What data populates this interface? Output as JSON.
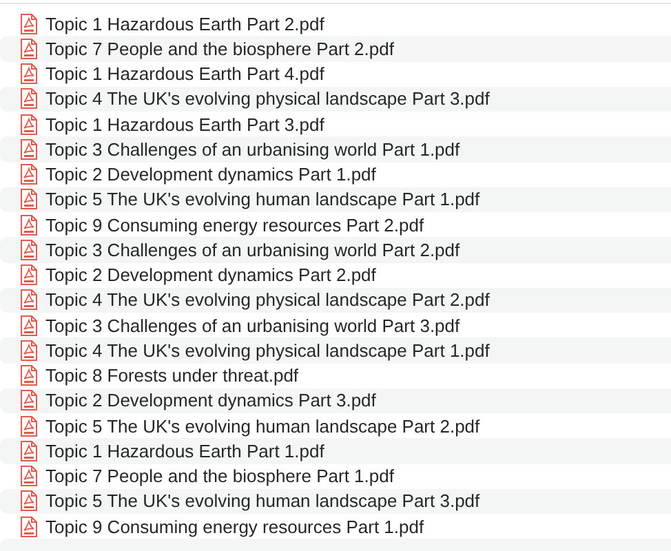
{
  "files": [
    {
      "name": "Topic 1 Hazardous Earth Part 2.pdf"
    },
    {
      "name": "Topic 7 People and the biosphere Part 2.pdf"
    },
    {
      "name": "Topic 1 Hazardous Earth Part 4.pdf"
    },
    {
      "name": "Topic 4 The UK's evolving physical landscape Part 3.pdf"
    },
    {
      "name": "Topic 1 Hazardous Earth Part 3.pdf"
    },
    {
      "name": "Topic 3 Challenges of an urbanising world Part 1.pdf"
    },
    {
      "name": "Topic 2 Development dynamics Part 1.pdf"
    },
    {
      "name": "Topic 5 The UK's evolving human landscape Part 1.pdf"
    },
    {
      "name": "Topic 9 Consuming energy resources Part 2.pdf"
    },
    {
      "name": "Topic 3 Challenges of an urbanising world Part 2.pdf"
    },
    {
      "name": "Topic 2 Development dynamics Part 2.pdf"
    },
    {
      "name": "Topic 4 The UK's evolving physical landscape Part 2.pdf"
    },
    {
      "name": "Topic 3 Challenges of an urbanising world Part 3.pdf"
    },
    {
      "name": "Topic 4 The UK's evolving physical landscape Part 1.pdf"
    },
    {
      "name": "Topic 8 Forests under threat.pdf"
    },
    {
      "name": "Topic 2 Development dynamics Part 3.pdf"
    },
    {
      "name": "Topic 5 The UK's evolving human landscape Part 2.pdf"
    },
    {
      "name": "Topic 1 Hazardous Earth Part 1.pdf"
    },
    {
      "name": "Topic 7 People and the biosphere Part 1.pdf"
    },
    {
      "name": "Topic 5 The UK's evolving human landscape Part 3.pdf"
    },
    {
      "name": "Topic 9 Consuming energy resources Part 1.pdf"
    }
  ]
}
